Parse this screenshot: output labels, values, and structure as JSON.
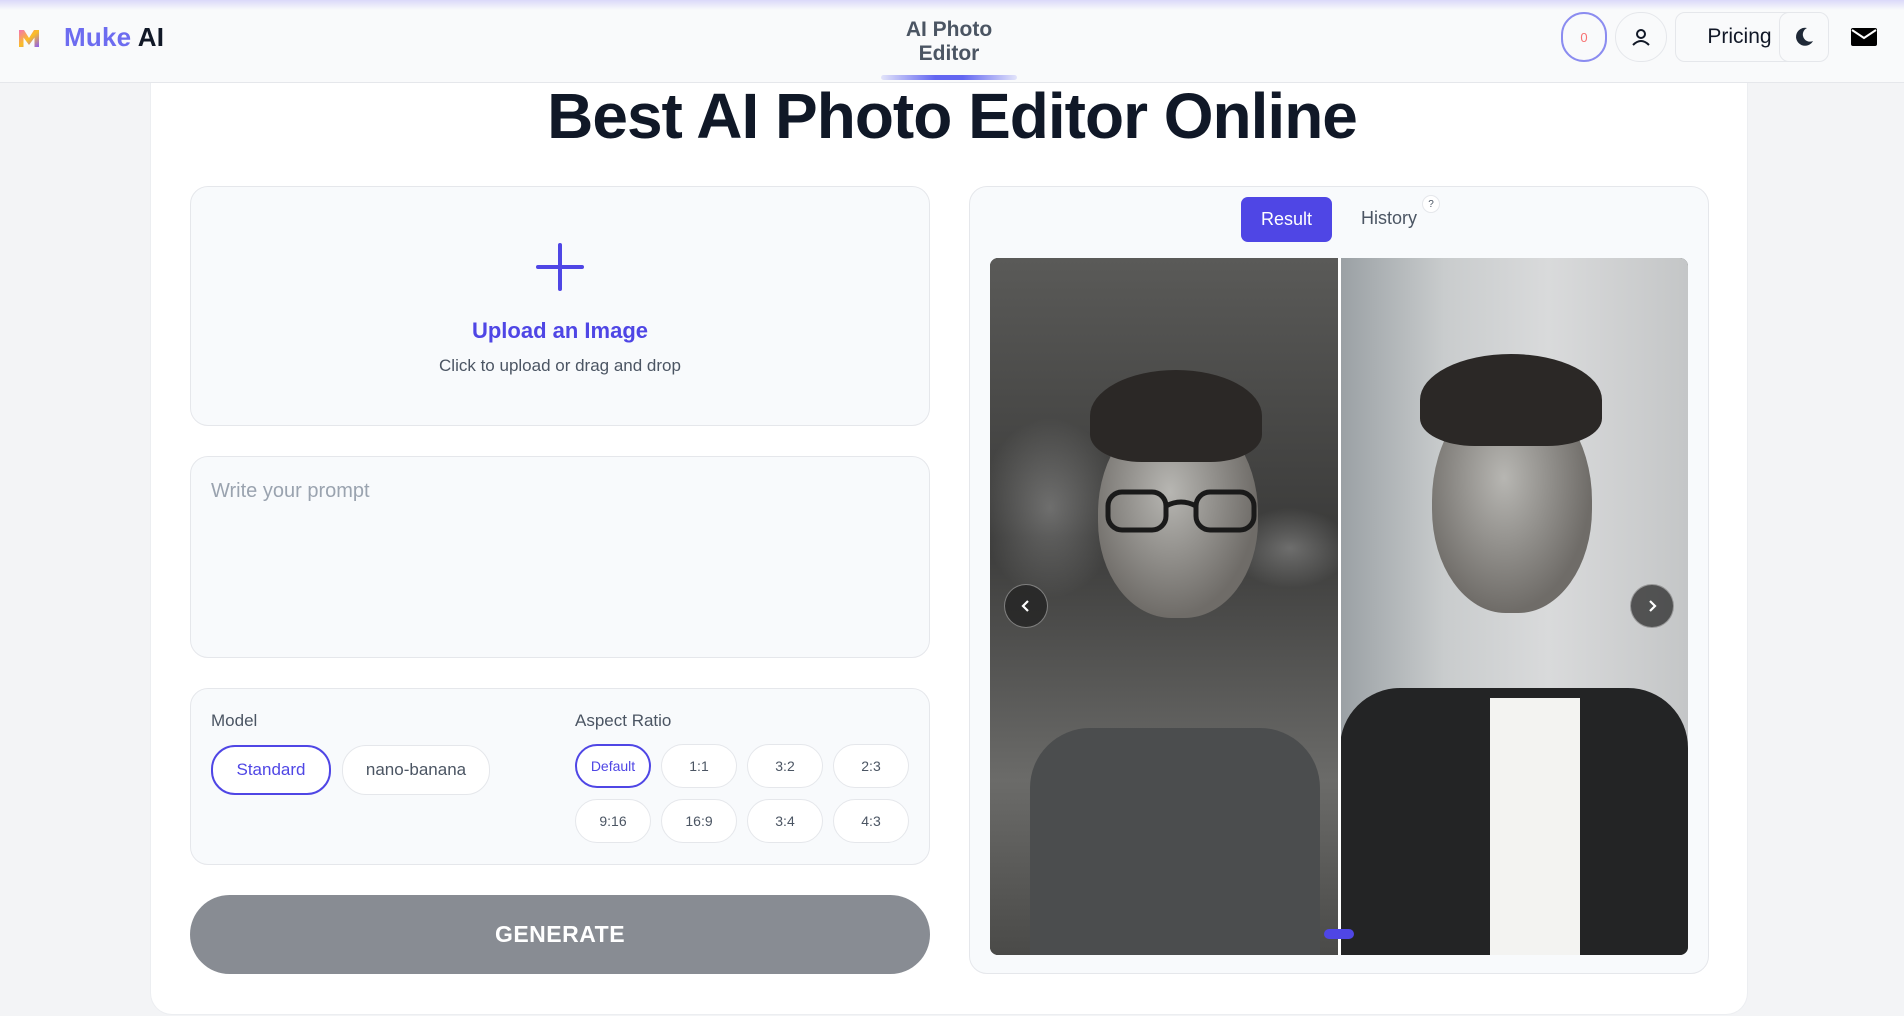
{
  "header": {
    "brand_part1": "Muke",
    "brand_part2": "AI",
    "nav_active": "AI Photo Editor",
    "credits": "0",
    "pricing": "Pricing",
    "icons": [
      "logo-icon",
      "user-icon",
      "moon-icon",
      "mail-icon"
    ]
  },
  "main": {
    "title": "Best AI Photo Editor Online",
    "upload": {
      "title": "Upload an Image",
      "subtitle": "Click to upload or drag and drop"
    },
    "prompt": {
      "placeholder": "Write your prompt",
      "value": ""
    },
    "model": {
      "label": "Model",
      "options": [
        "Standard",
        "nano-banana"
      ],
      "selected": "Standard"
    },
    "aspect_ratio": {
      "label": "Aspect Ratio",
      "options": [
        "Default",
        "1:1",
        "3:2",
        "2:3",
        "9:16",
        "16:9",
        "3:4",
        "4:3"
      ],
      "selected": "Default"
    },
    "generate": "GENERATE"
  },
  "result": {
    "tabs": [
      "Result",
      "History"
    ],
    "active_tab": "Result",
    "help": "?",
    "slides": 1,
    "current_slide": 1
  },
  "colors": {
    "accent": "#4f46e5",
    "generate_bg": "#888c93",
    "credits_text": "#f87171"
  }
}
